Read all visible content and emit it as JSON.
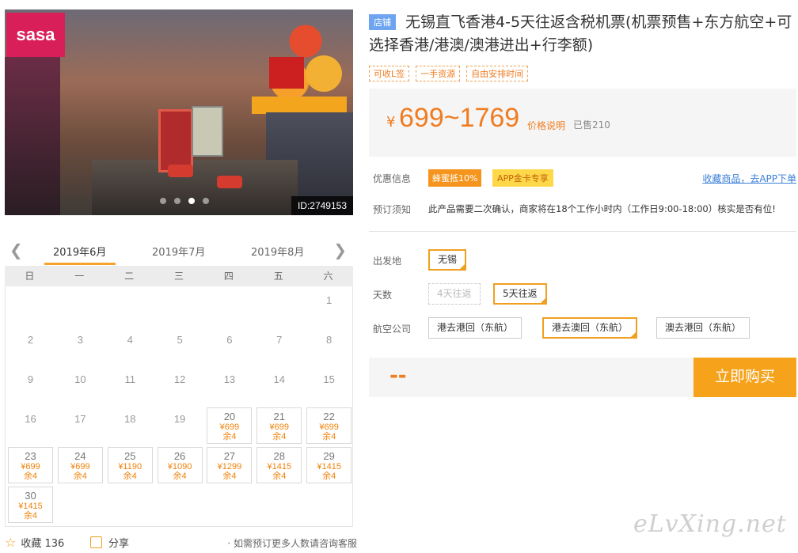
{
  "photo": {
    "image_id": "ID:2749153"
  },
  "calendar": {
    "months": [
      "2019年6月",
      "2019年7月",
      "2019年8月"
    ],
    "weekdays": [
      "日",
      "一",
      "二",
      "三",
      "四",
      "五",
      "六"
    ],
    "days": [
      {
        "d": "1"
      },
      {
        "d": "2"
      },
      {
        "d": "3"
      },
      {
        "d": "4"
      },
      {
        "d": "5"
      },
      {
        "d": "6"
      },
      {
        "d": "7"
      },
      {
        "d": "8"
      },
      {
        "d": "9"
      },
      {
        "d": "10"
      },
      {
        "d": "11"
      },
      {
        "d": "12"
      },
      {
        "d": "13"
      },
      {
        "d": "14"
      },
      {
        "d": "15"
      },
      {
        "d": "16"
      },
      {
        "d": "17"
      },
      {
        "d": "18"
      },
      {
        "d": "19"
      },
      {
        "d": "20",
        "price": "¥699",
        "remain": "余4"
      },
      {
        "d": "21",
        "price": "¥699",
        "remain": "余4"
      },
      {
        "d": "22",
        "price": "¥699",
        "remain": "余4"
      },
      {
        "d": "23",
        "price": "¥699",
        "remain": "余4"
      },
      {
        "d": "24",
        "price": "¥699",
        "remain": "余4"
      },
      {
        "d": "25",
        "price": "¥1190",
        "remain": "余4"
      },
      {
        "d": "26",
        "price": "¥1090",
        "remain": "余4"
      },
      {
        "d": "27",
        "price": "¥1299",
        "remain": "余4"
      },
      {
        "d": "28",
        "price": "¥1415",
        "remain": "余4"
      },
      {
        "d": "29",
        "price": "¥1415",
        "remain": "余4"
      },
      {
        "d": "30",
        "price": "¥1415",
        "remain": "余4"
      }
    ]
  },
  "footer": {
    "fav_label": "收藏",
    "fav_count": "136",
    "share_label": "分享",
    "note": "· 如需预订更多人数请咨询客服"
  },
  "product": {
    "store_badge": "店铺",
    "title": "无锡直飞香港4-5天往返含税机票(机票预售+东方航空+可选择香港/港澳/澳港进出+行李额)",
    "tags": [
      "可收L签",
      "一手资源",
      "自由安排时间"
    ],
    "price_currency": "¥",
    "price": "699~1769",
    "price_link": "价格说明",
    "sold": "已售210"
  },
  "promos": {
    "label": "优惠信息",
    "promo1": "蜂蜜抵10%",
    "promo2": "APP金卡专享",
    "fav_link": "收藏商品，去APP下单"
  },
  "notice": {
    "label": "预订须知",
    "text": "此产品需要二次确认，商家将在18个工作小时内（工作日9:00-18:00）核实是否有位!"
  },
  "options": {
    "departure_label": "出发地",
    "departure": [
      "无锡"
    ],
    "days_label": "天数",
    "days": [
      "4天往返",
      "5天往返"
    ],
    "airline_label": "航空公司",
    "airlines": [
      "港去港回（东航）",
      "港去澳回（东航）",
      "澳去港回（东航）"
    ]
  },
  "buy": {
    "total": "--",
    "button": "立即购买"
  },
  "watermark": "eLvXing.net",
  "colors": {
    "accent": "#f6a21b",
    "price": "#f07c20",
    "link": "#3a7fd5"
  }
}
